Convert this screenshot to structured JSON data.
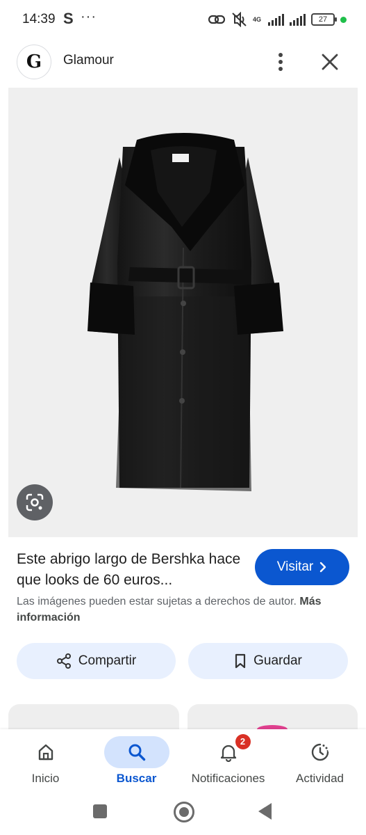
{
  "status_bar": {
    "time": "14:39",
    "app_icon": "S",
    "overflow": "···",
    "network_type": "4G",
    "battery": "27",
    "icons": [
      "link-icon",
      "mute-vibrate-icon",
      "signal-icon",
      "signal-icon",
      "battery-icon"
    ]
  },
  "header": {
    "logo_letter": "G",
    "site_name": "Glamour",
    "icons": [
      "more-vert-icon",
      "close-icon"
    ]
  },
  "image": {
    "subject": "black faux-leather long coat with faux-fur collar and cuffs",
    "lens_icon": "google-lens-icon"
  },
  "result": {
    "title": "Este abrigo largo de Bershka hace que looks de 60 euros...",
    "visit_label": "Visitar",
    "copyright_text": "Las imágenes pueden estar sujetas a derechos de autor.",
    "more_info_label": "Más información"
  },
  "actions": {
    "share_label": "Compartir",
    "save_label": "Guardar"
  },
  "bottom_nav": {
    "items": [
      {
        "label": "Inicio",
        "icon": "home-icon",
        "active": false
      },
      {
        "label": "Buscar",
        "icon": "search-icon",
        "active": true
      },
      {
        "label": "Notificaciones",
        "icon": "bell-icon",
        "active": false,
        "badge": "2"
      },
      {
        "label": "Actividad",
        "icon": "activity-icon",
        "active": false
      }
    ]
  },
  "colors": {
    "accent": "#0b57d0",
    "chip_background": "#e8f0fe",
    "active_nav_background": "#d3e3fd",
    "badge": "#d93025"
  }
}
